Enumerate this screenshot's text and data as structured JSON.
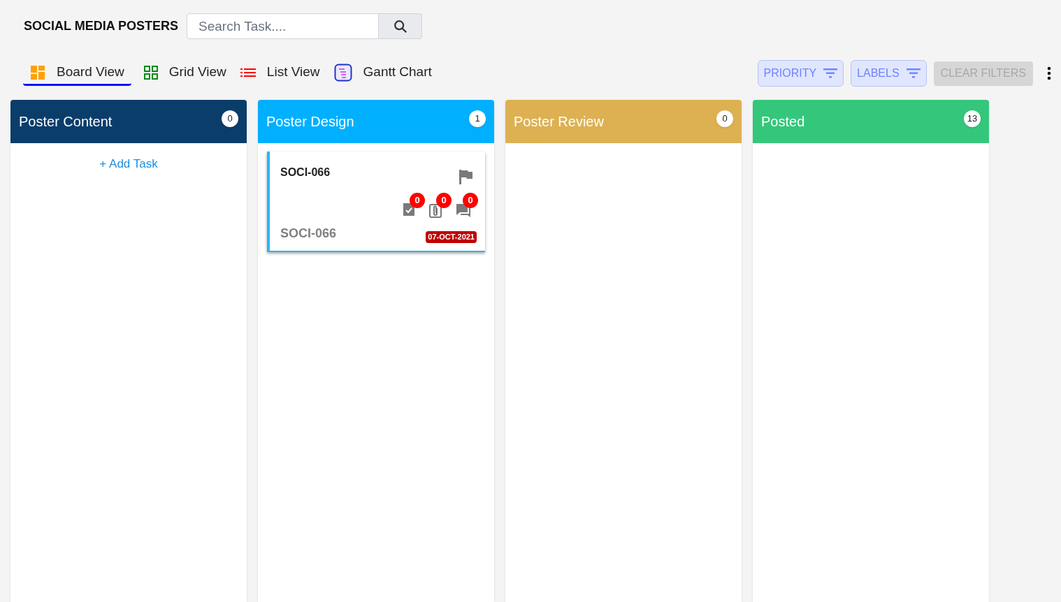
{
  "title": "SOCIAL MEDIA POSTERS",
  "search": {
    "placeholder": "Search Task...."
  },
  "views": [
    {
      "kind": "board",
      "label": "Board View",
      "selected": true
    },
    {
      "kind": "grid",
      "label": "Grid View",
      "selected": false
    },
    {
      "kind": "list",
      "label": "List View",
      "selected": false
    },
    {
      "kind": "gantt",
      "label": "Gantt Chart",
      "selected": false
    }
  ],
  "filters": [
    {
      "label": "PRIORITY",
      "disabled": false
    },
    {
      "label": "LABELS",
      "disabled": false
    },
    {
      "label": "CLEAR FILTERS",
      "disabled": true
    }
  ],
  "columns": [
    {
      "name": "Poster Content",
      "count": "0",
      "color": "#0b3d6b",
      "add_task": "+ Add Task"
    },
    {
      "name": "Poster Design",
      "count": "1",
      "color": "#00b0ff",
      "cards": [
        {
          "title": "SOCI-066",
          "code": "SOCI-066",
          "date": "07-OCT-2021",
          "counters": [
            {
              "kind": "checklist",
              "count": "0"
            },
            {
              "kind": "attachment",
              "count": "0"
            },
            {
              "kind": "comment",
              "count": "0"
            }
          ]
        }
      ]
    },
    {
      "name": "Poster Review",
      "count": "0",
      "color": "#ddb152"
    },
    {
      "name": "Posted",
      "count": "13",
      "color": "#34c77b"
    }
  ]
}
